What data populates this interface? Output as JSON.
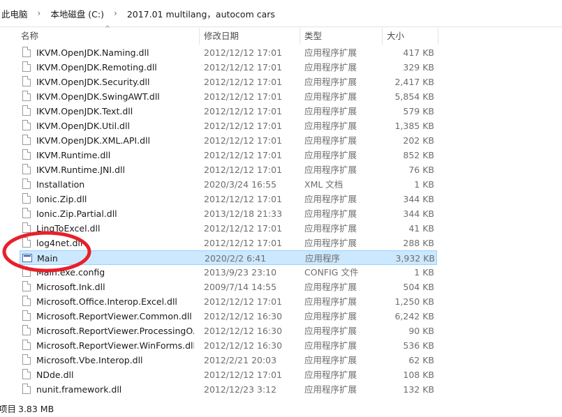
{
  "breadcrumb": [
    "此电脑",
    "本地磁盘 (C:)",
    "2017.01 multilang，autocom cars"
  ],
  "breadcrumb_separator": "›",
  "columns": {
    "name": "名称",
    "date": "修改日期",
    "type": "类型",
    "size": "大小"
  },
  "sort_indicator": "^",
  "selected_row": 14,
  "files": [
    {
      "name": "IKVM.OpenJDK.Naming.dll",
      "date": "2012/12/12 17:01",
      "type": "应用程序扩展",
      "size": "417 KB",
      "icon": "dll-file-icon"
    },
    {
      "name": "IKVM.OpenJDK.Remoting.dll",
      "date": "2012/12/12 17:01",
      "type": "应用程序扩展",
      "size": "329 KB",
      "icon": "dll-file-icon"
    },
    {
      "name": "IKVM.OpenJDK.Security.dll",
      "date": "2012/12/12 17:01",
      "type": "应用程序扩展",
      "size": "2,417 KB",
      "icon": "dll-file-icon"
    },
    {
      "name": "IKVM.OpenJDK.SwingAWT.dll",
      "date": "2012/12/12 17:01",
      "type": "应用程序扩展",
      "size": "5,854 KB",
      "icon": "dll-file-icon"
    },
    {
      "name": "IKVM.OpenJDK.Text.dll",
      "date": "2012/12/12 17:01",
      "type": "应用程序扩展",
      "size": "579 KB",
      "icon": "dll-file-icon"
    },
    {
      "name": "IKVM.OpenJDK.Util.dll",
      "date": "2012/12/12 17:01",
      "type": "应用程序扩展",
      "size": "1,385 KB",
      "icon": "dll-file-icon"
    },
    {
      "name": "IKVM.OpenJDK.XML.API.dll",
      "date": "2012/12/12 17:01",
      "type": "应用程序扩展",
      "size": "202 KB",
      "icon": "dll-file-icon"
    },
    {
      "name": "IKVM.Runtime.dll",
      "date": "2012/12/12 17:01",
      "type": "应用程序扩展",
      "size": "852 KB",
      "icon": "dll-file-icon"
    },
    {
      "name": "IKVM.Runtime.JNI.dll",
      "date": "2012/12/12 17:01",
      "type": "应用程序扩展",
      "size": "76 KB",
      "icon": "dll-file-icon"
    },
    {
      "name": "Installation",
      "date": "2020/3/24 16:55",
      "type": "XML 文档",
      "size": "1 KB",
      "icon": "xml-file-icon"
    },
    {
      "name": "Ionic.Zip.dll",
      "date": "2012/12/12 17:01",
      "type": "应用程序扩展",
      "size": "344 KB",
      "icon": "dll-file-icon"
    },
    {
      "name": "Ionic.Zip.Partial.dll",
      "date": "2013/12/18 21:33",
      "type": "应用程序扩展",
      "size": "344 KB",
      "icon": "dll-file-icon"
    },
    {
      "name": "LinqToExcel.dll",
      "date": "2012/12/12 17:01",
      "type": "应用程序扩展",
      "size": "41 KB",
      "icon": "dll-file-icon"
    },
    {
      "name": "log4net.dll",
      "date": "2012/12/12 17:01",
      "type": "应用程序扩展",
      "size": "288 KB",
      "icon": "dll-file-icon"
    },
    {
      "name": "Main",
      "date": "2020/2/2 6:41",
      "type": "应用程序",
      "size": "3,932 KB",
      "icon": "application-icon"
    },
    {
      "name": "Main.exe.config",
      "date": "2013/9/23 23:10",
      "type": "CONFIG 文件",
      "size": "1 KB",
      "icon": "config-file-icon"
    },
    {
      "name": "Microsoft.Ink.dll",
      "date": "2009/7/14 14:55",
      "type": "应用程序扩展",
      "size": "504 KB",
      "icon": "dll-file-icon"
    },
    {
      "name": "Microsoft.Office.Interop.Excel.dll",
      "date": "2012/12/12 17:01",
      "type": "应用程序扩展",
      "size": "1,250 KB",
      "icon": "dll-file-icon"
    },
    {
      "name": "Microsoft.ReportViewer.Common.dll",
      "date": "2012/12/12 16:30",
      "type": "应用程序扩展",
      "size": "6,242 KB",
      "icon": "dll-file-icon"
    },
    {
      "name": "Microsoft.ReportViewer.ProcessingO...",
      "date": "2012/12/12 16:30",
      "type": "应用程序扩展",
      "size": "90 KB",
      "icon": "dll-file-icon"
    },
    {
      "name": "Microsoft.ReportViewer.WinForms.dll",
      "date": "2012/12/12 16:30",
      "type": "应用程序扩展",
      "size": "536 KB",
      "icon": "dll-file-icon"
    },
    {
      "name": "Microsoft.Vbe.Interop.dll",
      "date": "2012/2/21 20:03",
      "type": "应用程序扩展",
      "size": "62 KB",
      "icon": "dll-file-icon"
    },
    {
      "name": "NDde.dll",
      "date": "2012/12/12 17:01",
      "type": "应用程序扩展",
      "size": "108 KB",
      "icon": "dll-file-icon"
    },
    {
      "name": "nunit.framework.dll",
      "date": "2012/12/23 3:12",
      "type": "应用程序扩展",
      "size": "132 KB",
      "icon": "dll-file-icon"
    }
  ],
  "status": {
    "count_label": "项目",
    "selection_size": "3.83 MB"
  },
  "annotation": {
    "shape": "red-circle-highlight",
    "color": "#e8202a"
  },
  "colors": {
    "selection_bg": "#cce8ff",
    "selection_border": "#99d1ff"
  }
}
